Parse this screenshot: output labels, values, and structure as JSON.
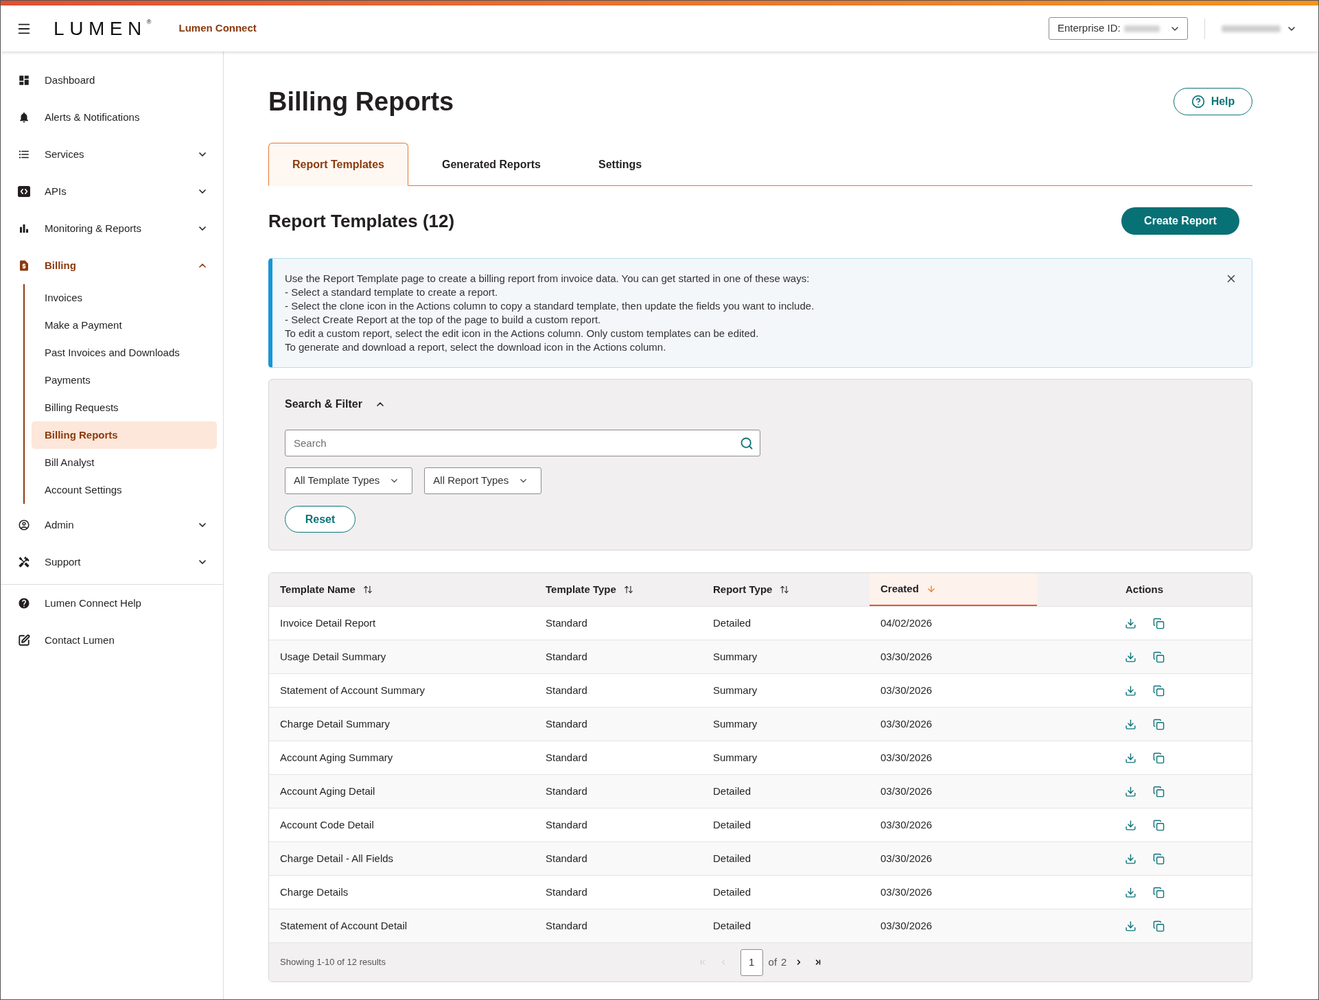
{
  "header": {
    "brand": "LUMEN",
    "brand_mark": "®",
    "app_name": "Lumen Connect",
    "enterprise_label": "Enterprise ID:"
  },
  "sidebar": {
    "items": [
      {
        "label": "Dashboard",
        "selected": false
      },
      {
        "label": "Alerts & Notifications",
        "selected": false
      },
      {
        "label": "Services",
        "selected": false,
        "expanded": false
      },
      {
        "label": "APIs",
        "selected": false,
        "expanded": false
      },
      {
        "label": "Monitoring & Reports",
        "selected": false,
        "expanded": false
      },
      {
        "label": "Billing",
        "selected": true,
        "expanded": true,
        "children": [
          {
            "label": "Invoices",
            "selected": false
          },
          {
            "label": "Make a Payment",
            "selected": false
          },
          {
            "label": "Past Invoices and Downloads",
            "selected": false
          },
          {
            "label": "Payments",
            "selected": false
          },
          {
            "label": "Billing Requests",
            "selected": false
          },
          {
            "label": "Billing Reports",
            "selected": true
          },
          {
            "label": "Bill Analyst",
            "selected": false
          },
          {
            "label": "Account Settings",
            "selected": false
          }
        ]
      },
      {
        "label": "Admin",
        "selected": false,
        "expanded": false
      },
      {
        "label": "Support",
        "selected": false,
        "expanded": false
      }
    ],
    "footer_links": [
      "Lumen Connect Help",
      "Contact Lumen"
    ]
  },
  "page": {
    "title": "Billing Reports",
    "help_button": "Help"
  },
  "tabs": [
    {
      "label": "Report Templates",
      "selected": true
    },
    {
      "label": "Generated Reports",
      "selected": false
    },
    {
      "label": "Settings",
      "selected": false
    }
  ],
  "section": {
    "title": "Report Templates (12)",
    "action_button": "Create Report"
  },
  "info_banner": {
    "lines": [
      "Use the Report Template page to create a billing report from invoice data. You can get started in one of these ways:",
      "- Select a standard template to create a report.",
      "- Select the clone icon in the Actions column to copy a standard template, then update the fields you want to include.",
      "- Select Create Report at the top of the page to build a custom report.",
      "To edit a custom report, select the edit icon in the Actions column. Only custom templates can be edited.",
      "To generate and download a report, select the download icon in the Actions column."
    ]
  },
  "search_filter": {
    "title": "Search & Filter",
    "expanded": true,
    "search": {
      "placeholder": "Search"
    },
    "dropdowns": [
      {
        "value": "All Template Types"
      },
      {
        "value": "All Report Types"
      }
    ],
    "reset_button": "Reset"
  },
  "table": {
    "columns": [
      {
        "label": "Template Name",
        "kind": "text",
        "sortable": true,
        "sorted": false
      },
      {
        "label": "Template Type",
        "kind": "text",
        "sortable": true,
        "sorted": false
      },
      {
        "label": "Report Type",
        "kind": "text",
        "sortable": true,
        "sorted": false
      },
      {
        "label": "Created",
        "kind": "text",
        "sortable": true,
        "sorted": true,
        "descending": true
      },
      {
        "label": "Actions",
        "kind": "actions"
      }
    ],
    "rows": [
      [
        "Invoice Detail Report",
        "Standard",
        "Detailed",
        "04/02/2026"
      ],
      [
        "Usage Detail Summary",
        "Standard",
        "Summary",
        "03/30/2026"
      ],
      [
        "Statement of Account Summary",
        "Standard",
        "Summary",
        "03/30/2026"
      ],
      [
        "Charge Detail Summary",
        "Standard",
        "Summary",
        "03/30/2026"
      ],
      [
        "Account Aging Summary",
        "Standard",
        "Summary",
        "03/30/2026"
      ],
      [
        "Account Aging Detail",
        "Standard",
        "Detailed",
        "03/30/2026"
      ],
      [
        "Account Code Detail",
        "Standard",
        "Detailed",
        "03/30/2026"
      ],
      [
        "Charge Detail - All Fields",
        "Standard",
        "Detailed",
        "03/30/2026"
      ],
      [
        "Charge Details",
        "Standard",
        "Detailed",
        "03/30/2026"
      ],
      [
        "Statement of Account Detail",
        "Standard",
        "Detailed",
        "03/30/2026"
      ]
    ],
    "pagination": {
      "summary": "Showing 1-10 of 12 results",
      "page": "1",
      "of_label": "of",
      "total_pages": "2",
      "controls": [
        {
          "kind": "first",
          "disabled": true
        },
        {
          "kind": "previous",
          "disabled": true
        },
        {
          "kind": "next",
          "disabled": false
        },
        {
          "kind": "last",
          "disabled": false
        }
      ]
    }
  }
}
